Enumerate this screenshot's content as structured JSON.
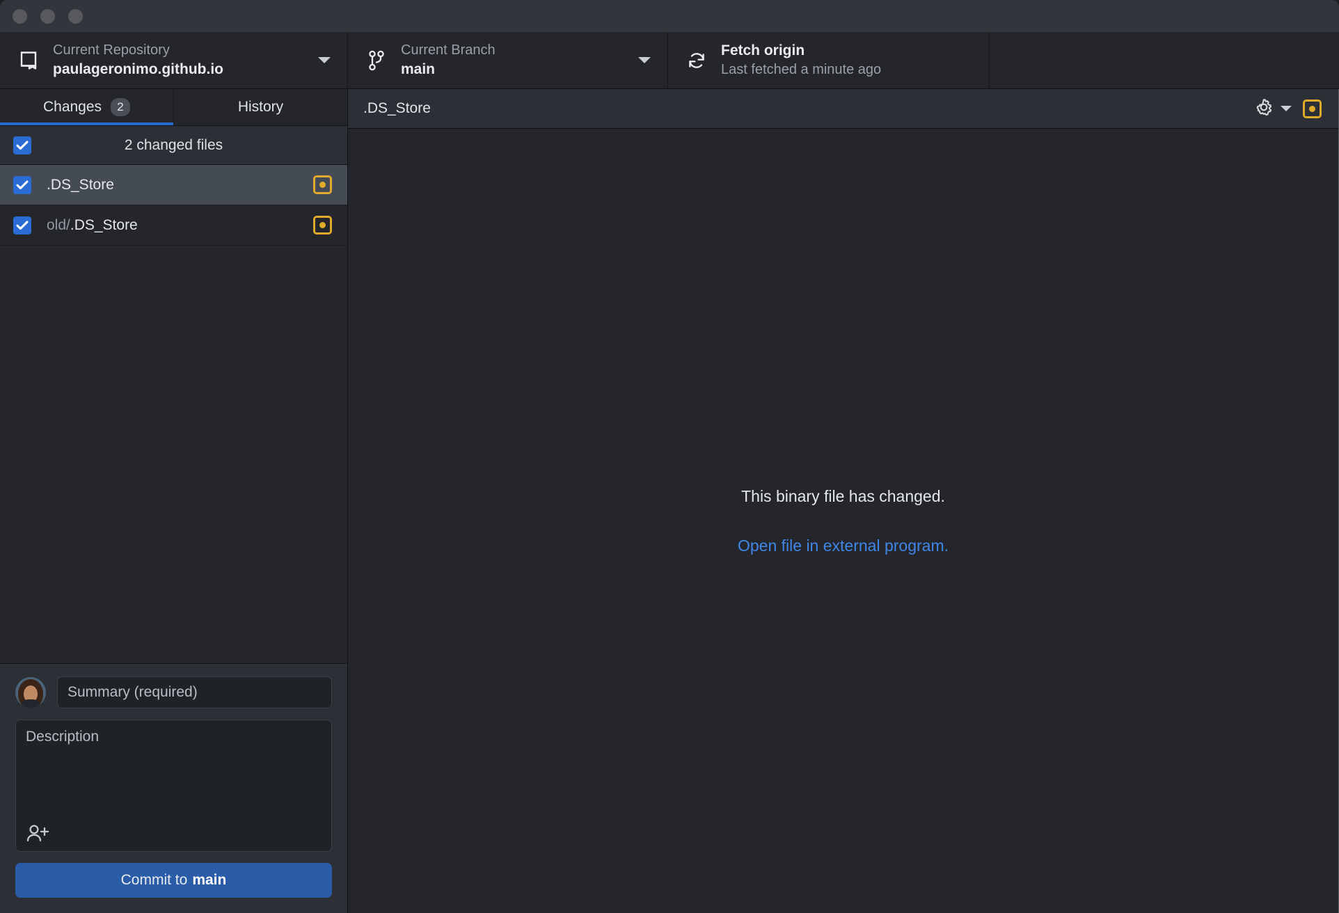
{
  "window": {
    "traffic_lights": [
      "close",
      "minimize",
      "zoom"
    ]
  },
  "toolbar": {
    "repository": {
      "icon": "repo-icon",
      "label": "Current Repository",
      "value": "paulageronimo.github.io",
      "caret": "chevron-down-icon"
    },
    "branch": {
      "icon": "branch-icon",
      "label": "Current Branch",
      "value": "main",
      "caret": "chevron-down-icon"
    },
    "fetch": {
      "icon": "sync-icon",
      "title": "Fetch origin",
      "subtitle": "Last fetched a minute ago"
    }
  },
  "sidebar": {
    "tabs": [
      {
        "label": "Changes",
        "badge": "2",
        "active": true
      },
      {
        "label": "History",
        "badge": "",
        "active": false
      }
    ],
    "summary_row": {
      "label": "2 changed files",
      "checked": true
    },
    "files": [
      {
        "dir": "",
        "name": ".DS_Store",
        "checked": true,
        "status": "modified",
        "selected": true
      },
      {
        "dir": "old/",
        "name": ".DS_Store",
        "checked": true,
        "status": "modified",
        "selected": false
      }
    ],
    "commit_form": {
      "avatar": "user-avatar",
      "summary_placeholder": "Summary (required)",
      "summary_value": "",
      "description_placeholder": "Description",
      "description_value": "",
      "coauthor_icon": "add-coauthor-icon",
      "commit_button_prefix": "Commit to",
      "commit_button_branch": "main"
    }
  },
  "diff": {
    "header": {
      "filename": ".DS_Store",
      "gear_icon": "gear-icon",
      "gear_caret": "chevron-down-icon",
      "status_badge": "modified"
    },
    "message": "This binary file has changed.",
    "link": "Open file in external program."
  },
  "colors": {
    "accent_blue": "#2b6cd4",
    "link_blue": "#3f86e8",
    "modified_yellow": "#e0ab2b",
    "commit_button": "#2b5ca8",
    "panel_bg": "#24262b",
    "header_bg": "#2c2f35",
    "selected_row": "#454b54",
    "titlebar_bg": "#32353b"
  }
}
